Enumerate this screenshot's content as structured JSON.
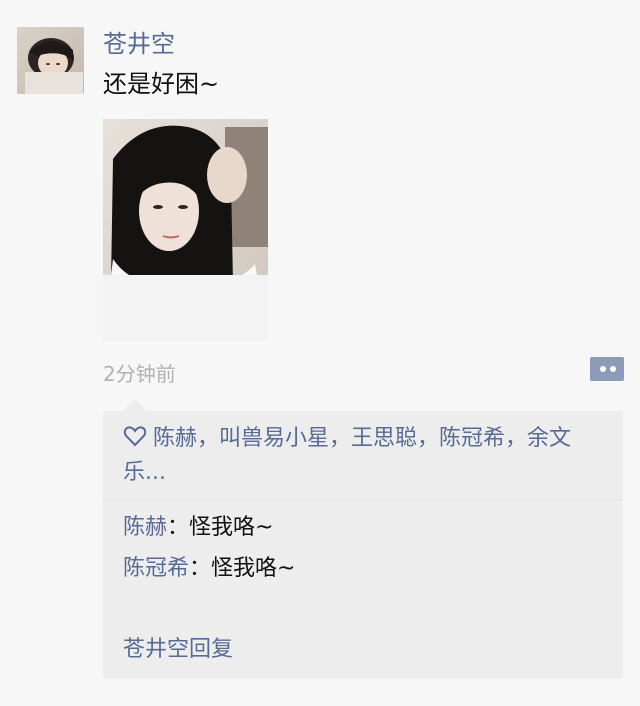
{
  "post": {
    "author": "苍井空",
    "text": "还是好困~",
    "time": "2分钟前",
    "image_alt": "selfie photo",
    "more_icon": "more-dots-icon",
    "accent_color": "#576b95"
  },
  "likes": {
    "icon": "heart-icon",
    "names": "陈赫，叫兽易小星，王思聪，陈冠希，余文乐..."
  },
  "comments": [
    {
      "author": "陈赫",
      "separator": "：",
      "text": "怪我咯~"
    },
    {
      "author": "陈冠希",
      "separator": "：",
      "text": "怪我咯~"
    }
  ],
  "reply": {
    "author": "苍井空",
    "label": "回复"
  }
}
